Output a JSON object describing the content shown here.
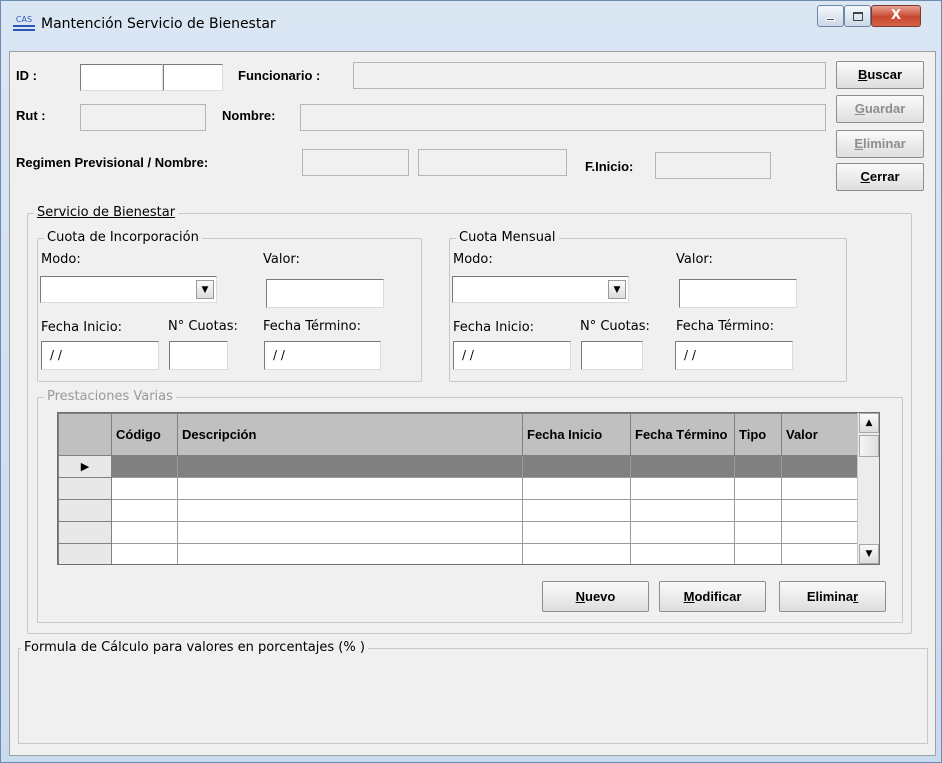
{
  "window": {
    "title": "Mantención Servicio de Bienestar",
    "icon_text": "CAS",
    "minimize_glyph": "",
    "maximize_glyph": "",
    "close_glyph": "X"
  },
  "header": {
    "id_label": "ID :",
    "funcionario_label": "Funcionario :",
    "rut_label": "Rut :",
    "nombre_label": "Nombre:",
    "regimen_label": "Regimen Previsional / Nombre:",
    "finicio_label": "F.Inicio:",
    "id_value": "",
    "id_check_value": "",
    "funcionario_value": "",
    "rut_value": "",
    "nombre_value": "",
    "regimen_code_value": "",
    "regimen_name_value": "",
    "finicio_value": ""
  },
  "buttons": {
    "buscar": {
      "accel": "B",
      "rest": "uscar"
    },
    "guardar": {
      "accel": "G",
      "rest": "uardar"
    },
    "eliminar": {
      "accel": "E",
      "rest": "liminar"
    },
    "cerrar": {
      "accel": "C",
      "rest": "errar"
    }
  },
  "servicio": {
    "title": "Servicio de Bienestar",
    "incorporacion": {
      "title": "Cuota de Incorporación",
      "modo_label": "Modo:",
      "valor_label": "Valor:",
      "fecha_inicio_label": "Fecha Inicio:",
      "cuotas_label": "N° Cuotas:",
      "fecha_termino_label": "Fecha Término:",
      "modo_value": "",
      "valor_value": "",
      "fecha_inicio_value": " / /",
      "cuotas_value": "",
      "fecha_termino_value": " / /"
    },
    "mensual": {
      "title": "Cuota Mensual",
      "modo_label": "Modo:",
      "valor_label": "Valor:",
      "fecha_inicio_label": "Fecha Inicio:",
      "cuotas_label": "N° Cuotas:",
      "fecha_termino_label": "Fecha Término:",
      "modo_value": "",
      "valor_value": "",
      "fecha_inicio_value": " / /",
      "cuotas_value": "",
      "fecha_termino_value": " / /"
    },
    "prestaciones": {
      "title": "Prestaciones Varias",
      "columns": [
        "Código",
        "Descripción",
        "Fecha Inicio",
        "Fecha Término",
        "Tipo",
        "Valor"
      ],
      "current_row_marker": "▶",
      "rows": [
        [
          "",
          "",
          "",
          "",
          "",
          ""
        ],
        [
          "",
          "",
          "",
          "",
          "",
          ""
        ],
        [
          "",
          "",
          "",
          "",
          "",
          ""
        ],
        [
          "",
          "",
          "",
          "",
          "",
          ""
        ],
        [
          "",
          "",
          "",
          "",
          "",
          ""
        ]
      ],
      "nuevo": {
        "accel": "N",
        "rest": "uevo"
      },
      "modificar": {
        "accel": "M",
        "rest": "odificar"
      },
      "eliminar": {
        "pre": "Elimina",
        "accel": "r"
      }
    }
  },
  "formula": {
    "title": "Formula de Cálculo para valores en porcentajes (% )"
  },
  "icons": {
    "scroll_up": "▲",
    "scroll_down": "▼",
    "combo_arrow": "▼"
  }
}
